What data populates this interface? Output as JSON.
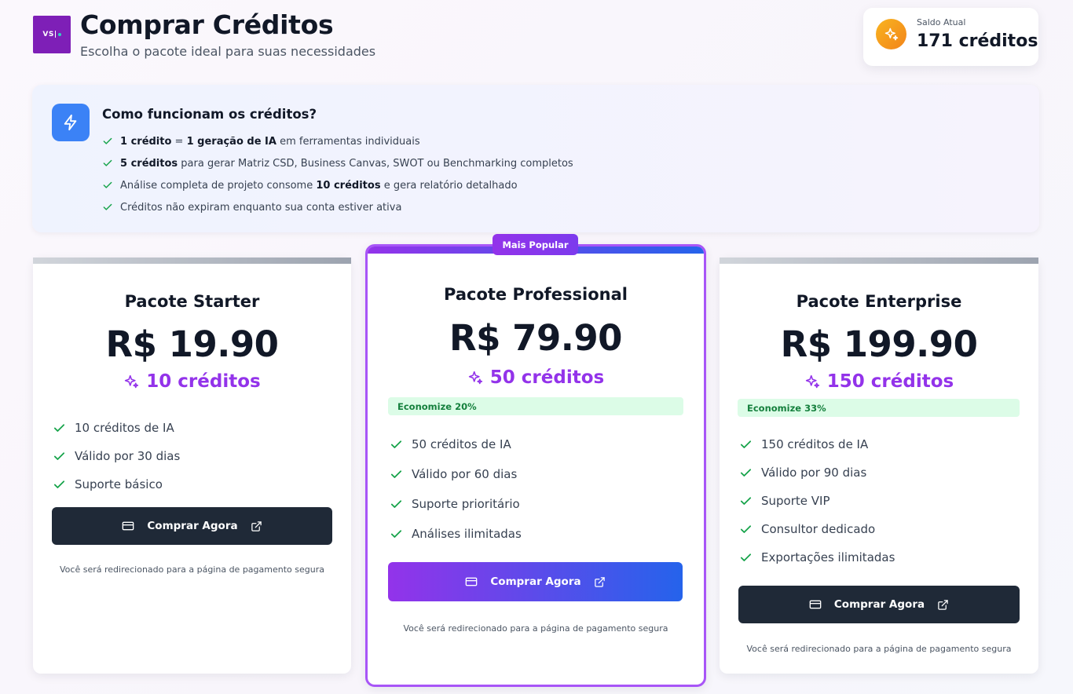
{
  "logo": {
    "text": "VS|"
  },
  "header": {
    "title": "Comprar Créditos",
    "subtitle": "Escolha o pacote ideal para suas necessidades"
  },
  "balance": {
    "label": "Saldo Atual",
    "value": "171 créditos",
    "icon": "sparkles-icon"
  },
  "info": {
    "title": "Como funcionam os créditos?",
    "icon": "lightning-icon",
    "items": [
      {
        "bold1": "1 crédito",
        "text1": " = ",
        "bold2": "1 geração de IA",
        "text2": " em ferramentas individuais"
      },
      {
        "bold1": "5 créditos",
        "text1": " para gerar Matriz CSD, Business Canvas, SWOT ou Benchmarking completos",
        "bold2": "",
        "text2": ""
      },
      {
        "bold1": "",
        "text1": "Análise completa de projeto consome ",
        "bold2": "10 créditos",
        "text2": " e gera relatório detalhado"
      },
      {
        "bold1": "",
        "text1": "Créditos não expiram enquanto sua conta estiver ativa",
        "bold2": "",
        "text2": ""
      }
    ]
  },
  "plans": {
    "starter": {
      "title": "Pacote Starter",
      "price": "R$ 19.90",
      "credits": "10 créditos",
      "features": [
        "10 créditos de IA",
        "Válido por 30 dias",
        "Suporte básico"
      ],
      "button": "Comprar Agora",
      "note": "Você será redirecionado para a página de pagamento segura"
    },
    "professional": {
      "badge": "Mais Popular",
      "title": "Pacote Professional",
      "price": "R$ 79.90",
      "credits": "50 créditos",
      "savings": "Economize 20%",
      "features": [
        "50 créditos de IA",
        "Válido por 60 dias",
        "Suporte prioritário",
        "Análises ilimitadas"
      ],
      "button": "Comprar Agora",
      "note": "Você será redirecionado para a página de pagamento segura"
    },
    "enterprise": {
      "title": "Pacote Enterprise",
      "price": "R$ 199.90",
      "credits": "150 créditos",
      "savings": "Economize 33%",
      "features": [
        "150 créditos de IA",
        "Válido por 90 dias",
        "Suporte VIP",
        "Consultor dedicado",
        "Exportações ilimitadas"
      ],
      "button": "Comprar Agora",
      "note": "Você será redirecionado para a página de pagamento segura"
    }
  },
  "colors": {
    "accent_purple": "#9333ea",
    "accent_blue": "#2563eb",
    "dark_button": "#1f2937",
    "check_green": "#16a34a",
    "savings_bg": "#dcfce7"
  }
}
